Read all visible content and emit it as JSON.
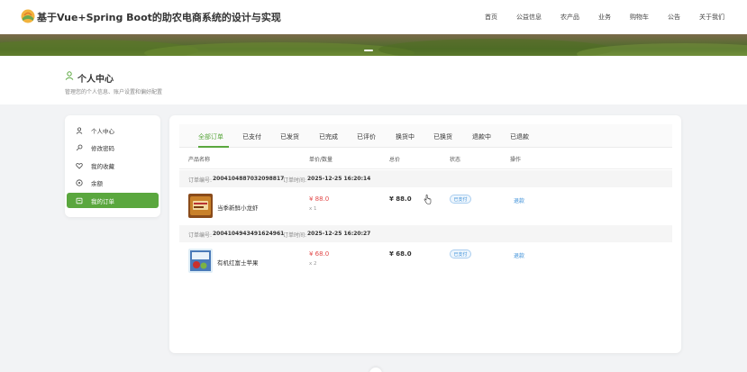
{
  "header": {
    "title": "基于Vue+Spring Boot的助农电商系统的设计与实现",
    "nav": [
      "首页",
      "公益信息",
      "农产品",
      "业务",
      "购物车",
      "公告",
      "关于我们"
    ]
  },
  "page": {
    "title": "个人中心",
    "subtitle": "管理您的个人信息、账户设置和偏好配置"
  },
  "sidebar": {
    "items": [
      {
        "label": "个人中心",
        "icon": "user-icon"
      },
      {
        "label": "修改密码",
        "icon": "key-icon"
      },
      {
        "label": "我的收藏",
        "icon": "heart-icon"
      },
      {
        "label": "余额",
        "icon": "wallet-icon"
      },
      {
        "label": "我的订单",
        "icon": "order-icon",
        "active": true
      }
    ]
  },
  "tabs": [
    "全部订单",
    "已支付",
    "已发货",
    "已完成",
    "已评价",
    "换货中",
    "已换货",
    "退款中",
    "已退款"
  ],
  "table": {
    "headers": [
      "产品名称",
      "单价/数量",
      "总价",
      "状态",
      "操作"
    ]
  },
  "orders": [
    {
      "order_no_label": "订单编号:",
      "order_no": "2004104887032098817",
      "time_label": "订单时间:",
      "time": "2025-12-25 16:20:14",
      "product": "当季新鲜小龙虾",
      "price": "¥ 88.0",
      "qty": "x 1",
      "total": "¥ 88.0",
      "status": "已支付",
      "action": "退款"
    },
    {
      "order_no_label": "订单编号:",
      "order_no": "2004104943491624961",
      "time_label": "订单时间:",
      "time": "2025-12-25 16:20:27",
      "product": "有机红富士苹果",
      "price": "¥ 68.0",
      "qty": "x 2",
      "total": "¥ 68.0",
      "status": "已支付",
      "action": "退款"
    }
  ],
  "colors": {
    "accent": "#5aa73e",
    "price": "#e24a4a",
    "link": "#3b8fd8"
  }
}
